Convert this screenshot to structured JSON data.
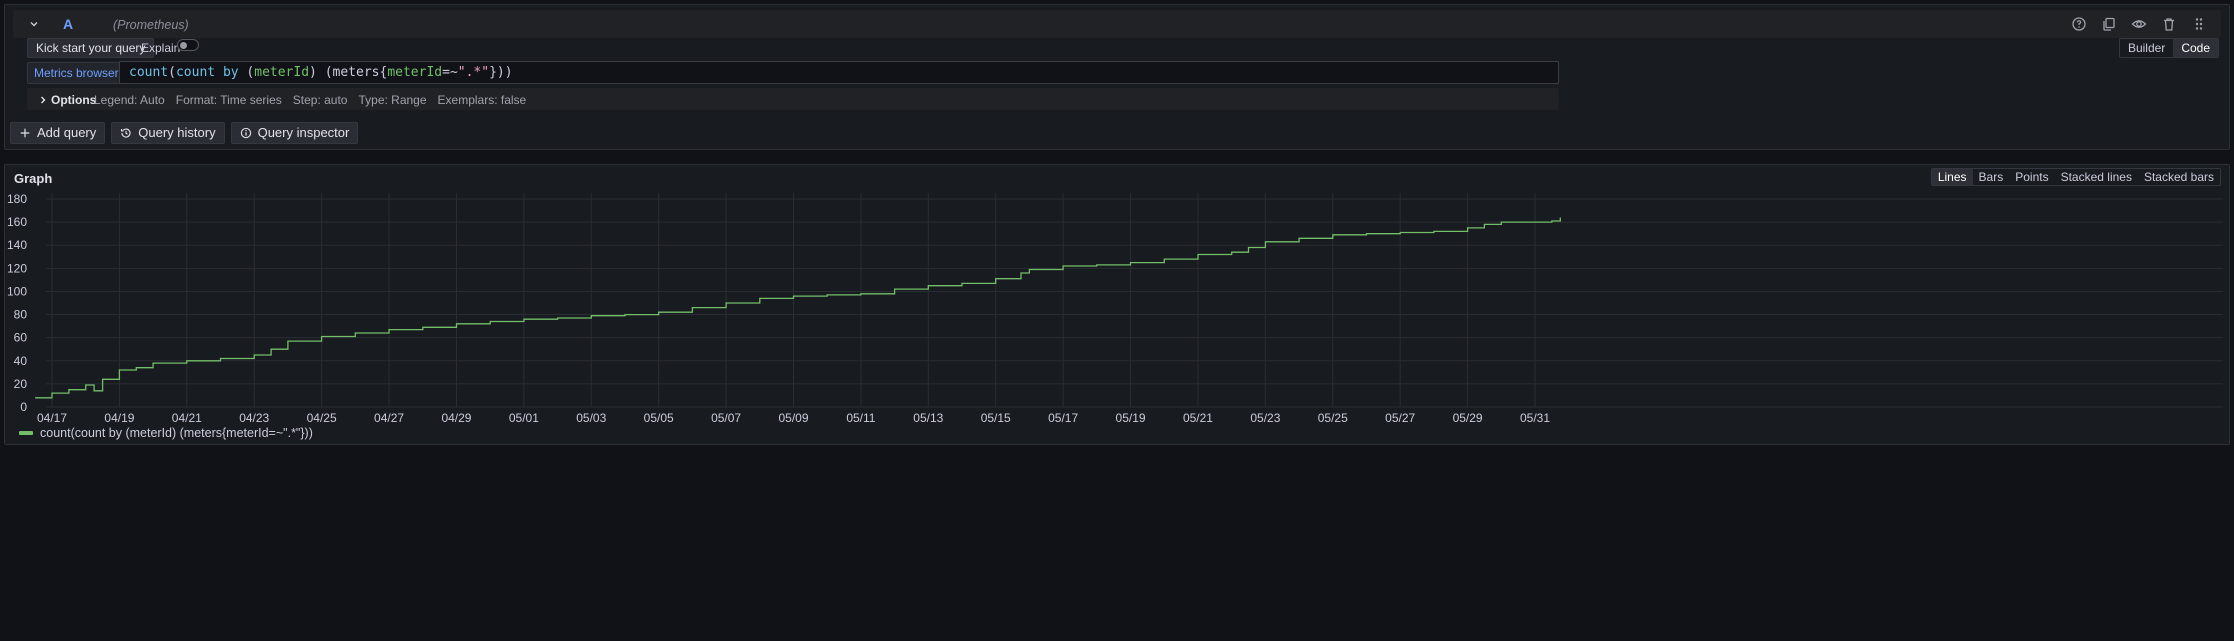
{
  "query": {
    "letter": "A",
    "datasource": "(Prometheus)",
    "kick_start_label": "Kick start your query",
    "explain_label": "Explain",
    "explain_on": false,
    "mode_builder": "Builder",
    "mode_code": "Code",
    "metrics_browser_label": "Metrics browser ›",
    "expr_parts": [
      "count",
      "(",
      "count",
      " ",
      "by",
      " (",
      "meterId",
      ") (meters{",
      "meterId",
      "=~",
      "\".*\"",
      "}))"
    ],
    "options_label": "Options",
    "options": [
      "Legend: Auto",
      "Format: Time series",
      "Step: auto",
      "Type: Range",
      "Exemplars: false"
    ]
  },
  "actions": {
    "add_query": "Add query",
    "query_history": "Query history",
    "query_inspector": "Query inspector"
  },
  "graph": {
    "title": "Graph",
    "display_modes": [
      "Lines",
      "Bars",
      "Points",
      "Stacked lines",
      "Stacked bars"
    ],
    "active_mode": "Lines"
  },
  "chart_data": {
    "type": "line",
    "x_label": "",
    "y_label": "",
    "ylim": [
      0,
      180
    ],
    "y_ticks": [
      0,
      20,
      40,
      60,
      80,
      100,
      120,
      140,
      160,
      180
    ],
    "x_ticks": [
      "04/17",
      "04/19",
      "04/21",
      "04/23",
      "04/25",
      "04/27",
      "04/29",
      "05/01",
      "05/03",
      "05/05",
      "05/07",
      "05/09",
      "05/11",
      "05/13",
      "05/15",
      "05/17",
      "05/19",
      "05/21",
      "05/23",
      "05/25",
      "05/27",
      "05/29",
      "05/31"
    ],
    "grid": true,
    "legend_position": "bottom-left",
    "series": [
      {
        "name": "count(count by (meterId) (meters{meterId=~\".*\"}))",
        "color": "#73bf69",
        "x": [
          "04/16 12:00",
          "04/17 00:00",
          "04/17 12:00",
          "04/18 00:00",
          "04/18 06:00",
          "04/18 12:00",
          "04/19 00:00",
          "04/19 12:00",
          "04/20 00:00",
          "04/21 00:00",
          "04/22 00:00",
          "04/23 00:00",
          "04/23 12:00",
          "04/24 00:00",
          "04/25 00:00",
          "04/26 00:00",
          "04/27 00:00",
          "04/28 00:00",
          "04/29 00:00",
          "04/30 00:00",
          "05/01 00:00",
          "05/02 00:00",
          "05/03 00:00",
          "05/04 00:00",
          "05/05 00:00",
          "05/06 00:00",
          "05/07 00:00",
          "05/08 00:00",
          "05/09 00:00",
          "05/10 00:00",
          "05/11 00:00",
          "05/12 00:00",
          "05/13 00:00",
          "05/14 00:00",
          "05/15 00:00",
          "05/15 18:00",
          "05/16 00:00",
          "05/17 00:00",
          "05/18 00:00",
          "05/19 00:00",
          "05/20 00:00",
          "05/21 00:00",
          "05/22 00:00",
          "05/22 12:00",
          "05/23 00:00",
          "05/24 00:00",
          "05/25 00:00",
          "05/26 00:00",
          "05/27 00:00",
          "05/28 00:00",
          "05/29 00:00",
          "05/29 12:00",
          "05/30 00:00",
          "05/31 00:00",
          "05/31 12:00",
          "05/31 18:00"
        ],
        "y": [
          8,
          12,
          15,
          19,
          14,
          24,
          32,
          34,
          38,
          40,
          42,
          45,
          50,
          57,
          61,
          64,
          67,
          69,
          72,
          74,
          76,
          77,
          79,
          80,
          82,
          86,
          90,
          94,
          96,
          97,
          98,
          102,
          105,
          107,
          111,
          116,
          119,
          122,
          123,
          125,
          128,
          132,
          134,
          138,
          143,
          146,
          149,
          150,
          151,
          152,
          155,
          158,
          160,
          160,
          161,
          164
        ]
      }
    ]
  }
}
